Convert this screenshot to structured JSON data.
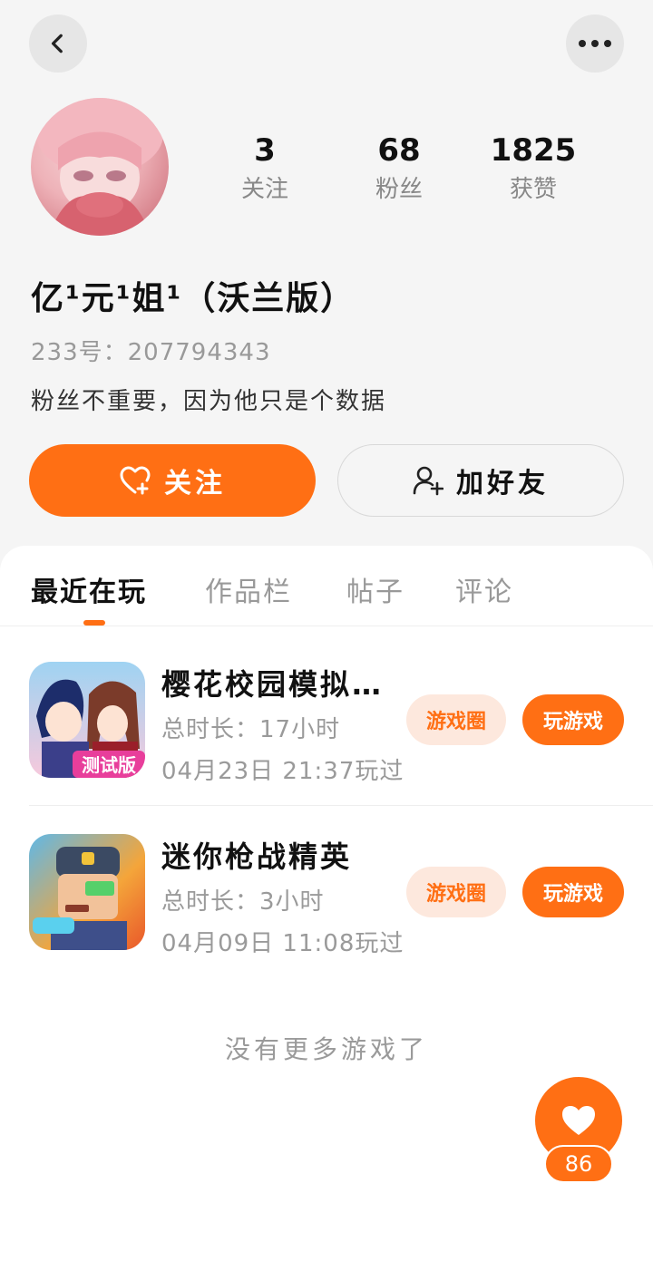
{
  "header": {
    "back_icon": "chevron-left-icon",
    "more_icon": "more-dots-icon"
  },
  "profile": {
    "stats": [
      {
        "value": "3",
        "label": "关注"
      },
      {
        "value": "68",
        "label": "粉丝"
      },
      {
        "value": "1825",
        "label": "获赞"
      }
    ],
    "username": "亿¹元¹姐¹（沃兰版）",
    "uid_label": "233号：",
    "uid": "207794343",
    "bio": "粉丝不重要，因为他只是个数据"
  },
  "actions": {
    "follow_label": "关注",
    "add_friend_label": "加好友"
  },
  "tabs": [
    {
      "label": "最近在玩",
      "active": true
    },
    {
      "label": "作品栏",
      "active": false
    },
    {
      "label": "帖子",
      "active": false
    },
    {
      "label": "评论",
      "active": false
    }
  ],
  "games": [
    {
      "title": "樱花校园模拟…",
      "duration": "总时长：17小时",
      "last_played": "04月23日 21:37玩过",
      "circle_label": "游戏圈",
      "play_label": "玩游戏",
      "icon_badge": "测试版"
    },
    {
      "title": "迷你枪战精英",
      "duration": "总时长：3小时",
      "last_played": "04月09日 11:08玩过",
      "circle_label": "游戏圈",
      "play_label": "玩游戏"
    }
  ],
  "footer": {
    "no_more": "没有更多游戏了"
  },
  "like": {
    "count": "86"
  },
  "colors": {
    "accent": "#ff6f14",
    "accent_light": "#fde8dd",
    "background": "#f5f5f5"
  }
}
